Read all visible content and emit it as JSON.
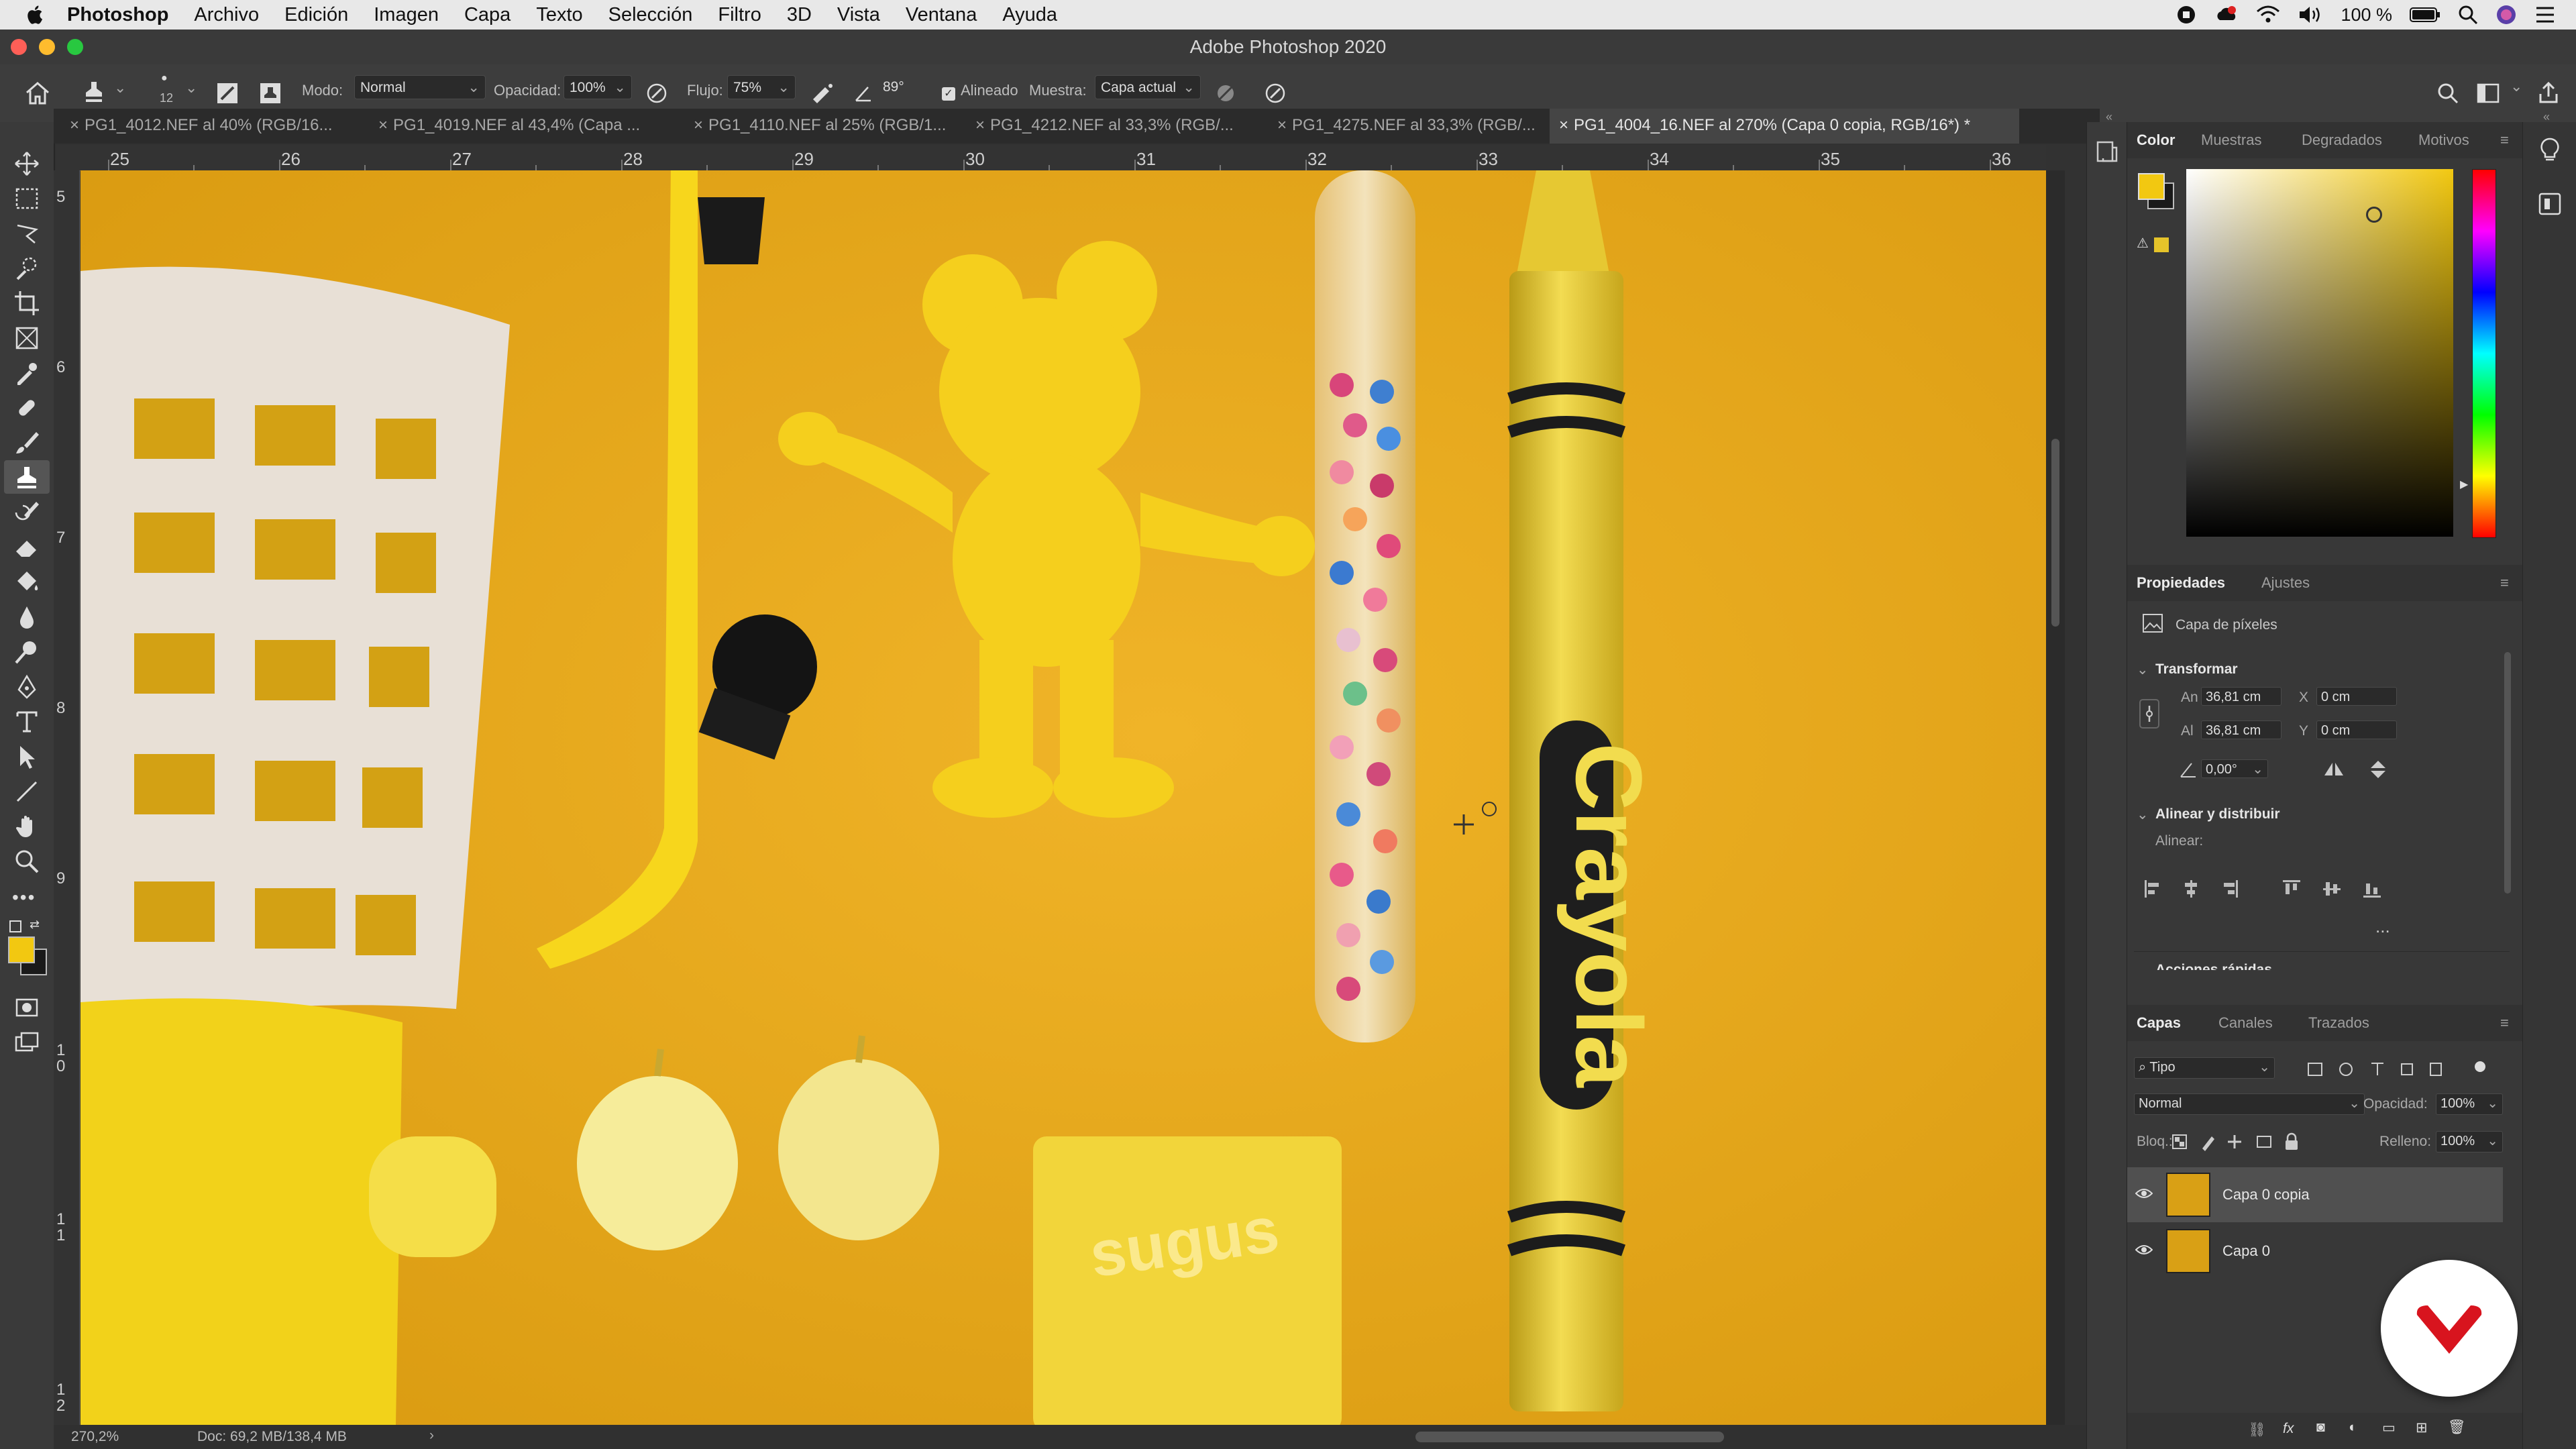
{
  "menubar": {
    "app": "Photoshop",
    "items": [
      "Archivo",
      "Edición",
      "Imagen",
      "Capa",
      "Texto",
      "Selección",
      "Filtro",
      "3D",
      "Vista",
      "Ventana",
      "Ayuda"
    ],
    "battery": "100 %"
  },
  "window": {
    "title": "Adobe Photoshop 2020"
  },
  "options": {
    "brush_size": "12",
    "mode_label": "Modo:",
    "mode_value": "Normal",
    "opacity_label": "Opacidad:",
    "opacity_value": "100%",
    "flow_label": "Flujo:",
    "flow_value": "75%",
    "angle_value": "89°",
    "aligned_label": "Alineado",
    "sample_label": "Muestra:",
    "sample_value": "Capa actual"
  },
  "tabs": [
    "PG1_4012.NEF al 40% (RGB/16...",
    "PG1_4019.NEF al 43,4% (Capa ...",
    "PG1_4110.NEF al 25% (RGB/1...",
    "PG1_4212.NEF al 33,3% (RGB/...",
    "PG1_4275.NEF al 33,3% (RGB/...",
    "PG1_4004_16.NEF al 270% (Capa 0 copia, RGB/16*) *"
  ],
  "ruler": {
    "top": [
      "25",
      "26",
      "27",
      "28",
      "29",
      "30",
      "31",
      "32",
      "33",
      "34",
      "35",
      "36"
    ],
    "left": [
      "5",
      "6",
      "7",
      "8",
      "9",
      "1\n0",
      "1\n1",
      "1\n2"
    ]
  },
  "canvas": {
    "brand_text": "Crayola",
    "candy_text": "sugus"
  },
  "status": {
    "zoom": "270,2%",
    "doc": "Doc: 69,2 MB/138,4 MB"
  },
  "color_panel": {
    "tabs": [
      "Color",
      "Muestras",
      "Degradados",
      "Motivos"
    ],
    "fg_color": "#f2c811",
    "bg_color": "#ffffff"
  },
  "properties": {
    "tabs": [
      "Propiedades",
      "Ajustes"
    ],
    "layer_kind": "Capa de píxeles",
    "transform_title": "Transformar",
    "w_label": "An",
    "w_value": "36,81 cm",
    "h_label": "Al",
    "h_value": "36,81 cm",
    "x_label": "X",
    "x_value": "0 cm",
    "y_label": "Y",
    "y_value": "0 cm",
    "angle_value": "0,00°",
    "align_title": "Alinear y distribuir",
    "align_label": "Alinear:",
    "more": "...",
    "quick_actions": "Acciones rápidas"
  },
  "layers": {
    "tabs": [
      "Capas",
      "Canales",
      "Trazados"
    ],
    "filter_value": "Tipo",
    "blend_value": "Normal",
    "opacity_label": "Opacidad:",
    "opacity_value": "100%",
    "lock_label": "Bloq.:",
    "fill_label": "Relleno:",
    "fill_value": "100%",
    "items": [
      {
        "name": "Capa 0 copia"
      },
      {
        "name": "Capa 0"
      }
    ]
  }
}
